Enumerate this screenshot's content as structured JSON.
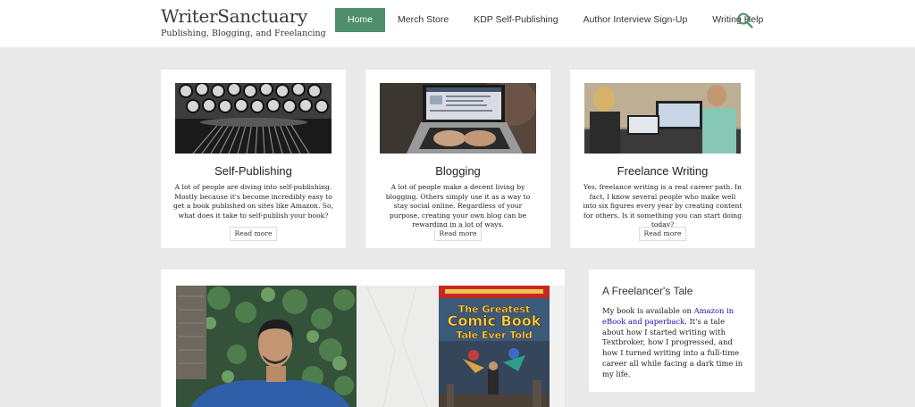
{
  "site": {
    "title": "WriterSanctuary",
    "tagline": "Publishing, Blogging, and Freelancing"
  },
  "nav": {
    "items": [
      "Home",
      "Merch Store",
      "KDP Self-Publishing",
      "Author Interview Sign-Up",
      "Writing Help"
    ],
    "active": "Home",
    "search_icon": "search-icon"
  },
  "cards": [
    {
      "title": "Self-Publishing",
      "text": "A lot of people are diving into self-publishing. Mostly because it's become incredibly easy to get a book published on sites like Amazon. So, what does it take to self-publish your book?",
      "more": "Read more"
    },
    {
      "title": "Blogging",
      "text": "A lot of people make a decent living by blogging. Others simply use it as a way to stay social online. Regardless of your purpose, creating your own blog can be rewarding in a lot of ways.",
      "more": "Read more"
    },
    {
      "title": "Freelance Writing",
      "text": "Yes, freelance writing is a real career path. In fact, I know several people who make well into six figures every year by creating content for others. Is it something you can start doing today?",
      "more": "Read more"
    }
  ],
  "feature": {
    "book_cover_title": "The Greatest Comic Book Tale Ever Told"
  },
  "sidebar": {
    "title": "A Freelancer's Tale",
    "text_before": "My book is available on ",
    "link": "Amazon in eBook and paperback",
    "text_after": ". It's a tale about how I started writing with Textbroker, how I progressed, and how I turned writing into a full-time career all while facing a dark time in my life."
  },
  "colors": {
    "accent": "#4d8f6b",
    "page_bg": "#e9e9e9",
    "link": "#1a0dab"
  }
}
